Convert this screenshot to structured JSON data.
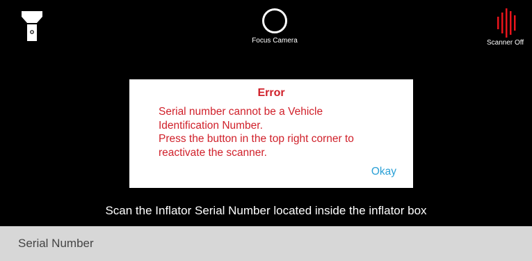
{
  "toolbar": {
    "flashlight_icon": "flashlight-icon",
    "focus_label": "Focus Camera",
    "scanner_label": "Scanner Off",
    "scanner_color": "#e8141b"
  },
  "dialog": {
    "title": "Error",
    "message": "Serial number cannot be a Vehicle\nIdentification Number.\n Press the button in the top right corner to\nreactivate the scanner.",
    "okay_label": "Okay",
    "text_color": "#d0202a",
    "button_color": "#2aa0d6"
  },
  "scan": {
    "instruction": "Scan the Inflator Serial Number located inside the inflator box"
  },
  "serial_field": {
    "placeholder": "Serial Number",
    "value": ""
  }
}
